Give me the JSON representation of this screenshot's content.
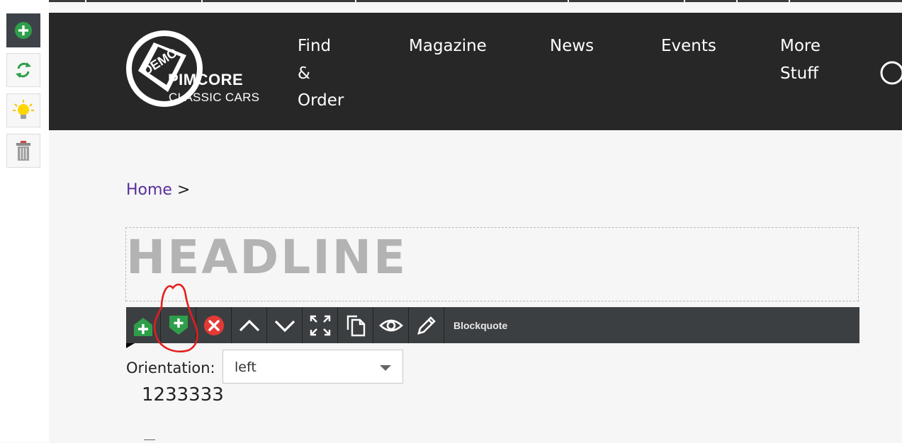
{
  "nav": {
    "items": [
      {
        "line1": "Find",
        "line2": "&",
        "line3": "Order"
      },
      {
        "line1": "Magazine"
      },
      {
        "line1": "News"
      },
      {
        "line1": "Events"
      },
      {
        "line1": "More",
        "line2": "Stuff"
      }
    ]
  },
  "logo": {
    "badge": "DEMO",
    "name": "PIMCORE",
    "subtitle": "CLASSIC CARS"
  },
  "breadcrumb": {
    "home": "Home",
    "separator": ">"
  },
  "headline": {
    "placeholder": "HEADLINE"
  },
  "toolbar": {
    "block_label": "Blockquote"
  },
  "orientation": {
    "label": "Orientation:",
    "selected": "left"
  },
  "content": {
    "value": "1233333"
  },
  "colors": {
    "header_bg": "#272727",
    "toolbar_bg": "#3c3f42",
    "link": "#5b2d9c",
    "add_green": "#2e9e4a",
    "delete_red": "#e53935",
    "annotation_red": "#e41e1e"
  }
}
